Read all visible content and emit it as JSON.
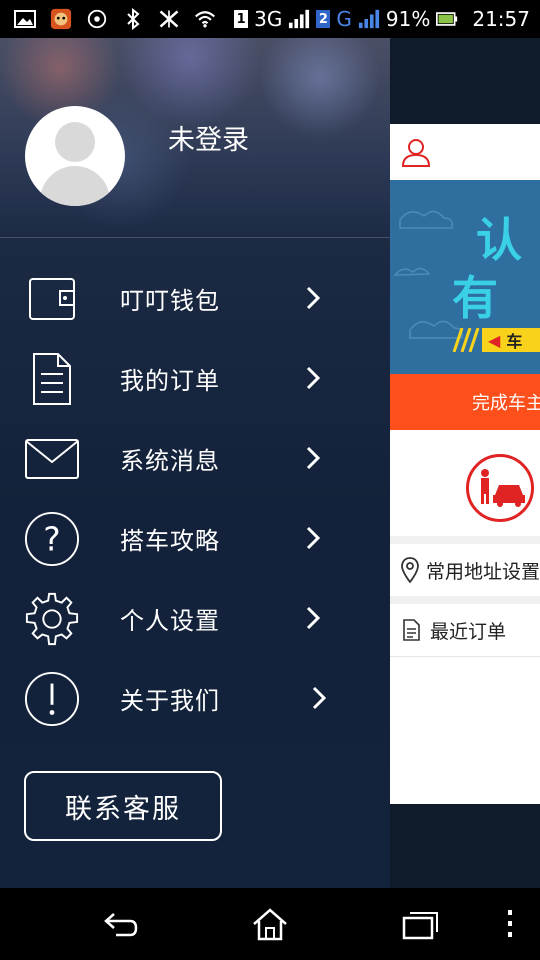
{
  "status_bar": {
    "network1": "3G",
    "network2": "G",
    "sim1": "1",
    "sim2": "2",
    "battery": "91%",
    "time": "21:57",
    "icons": [
      "gallery-icon",
      "game-icon",
      "camera-icon",
      "bluetooth-icon",
      "data-off-icon",
      "wifi-icon",
      "signal-icon",
      "battery-icon"
    ]
  },
  "drawer": {
    "user_status": "未登录",
    "menu": [
      {
        "label": "叮叮钱包",
        "icon": "wallet-icon"
      },
      {
        "label": "我的订单",
        "icon": "order-document-icon"
      },
      {
        "label": "系统消息",
        "icon": "mail-icon"
      },
      {
        "label": "搭车攻略",
        "icon": "help-question-icon"
      },
      {
        "label": "个人设置",
        "icon": "gear-icon"
      },
      {
        "label": "关于我们",
        "icon": "info-exclamation-icon"
      }
    ],
    "contact_button": "联系客服"
  },
  "panel": {
    "banner": {
      "line1": "认",
      "line2": "有",
      "strip_text": "车"
    },
    "orange_bar": "完成车主",
    "rows": [
      {
        "label": "常用地址设置",
        "icon": "location-pin-icon"
      },
      {
        "label": "最近订单",
        "icon": "document-icon"
      }
    ]
  },
  "colors": {
    "accent_orange": "#fc4f1c",
    "accent_red": "#e02323",
    "drawer_bg": "#13223a",
    "banner_cyan": "#3ad0e6"
  }
}
